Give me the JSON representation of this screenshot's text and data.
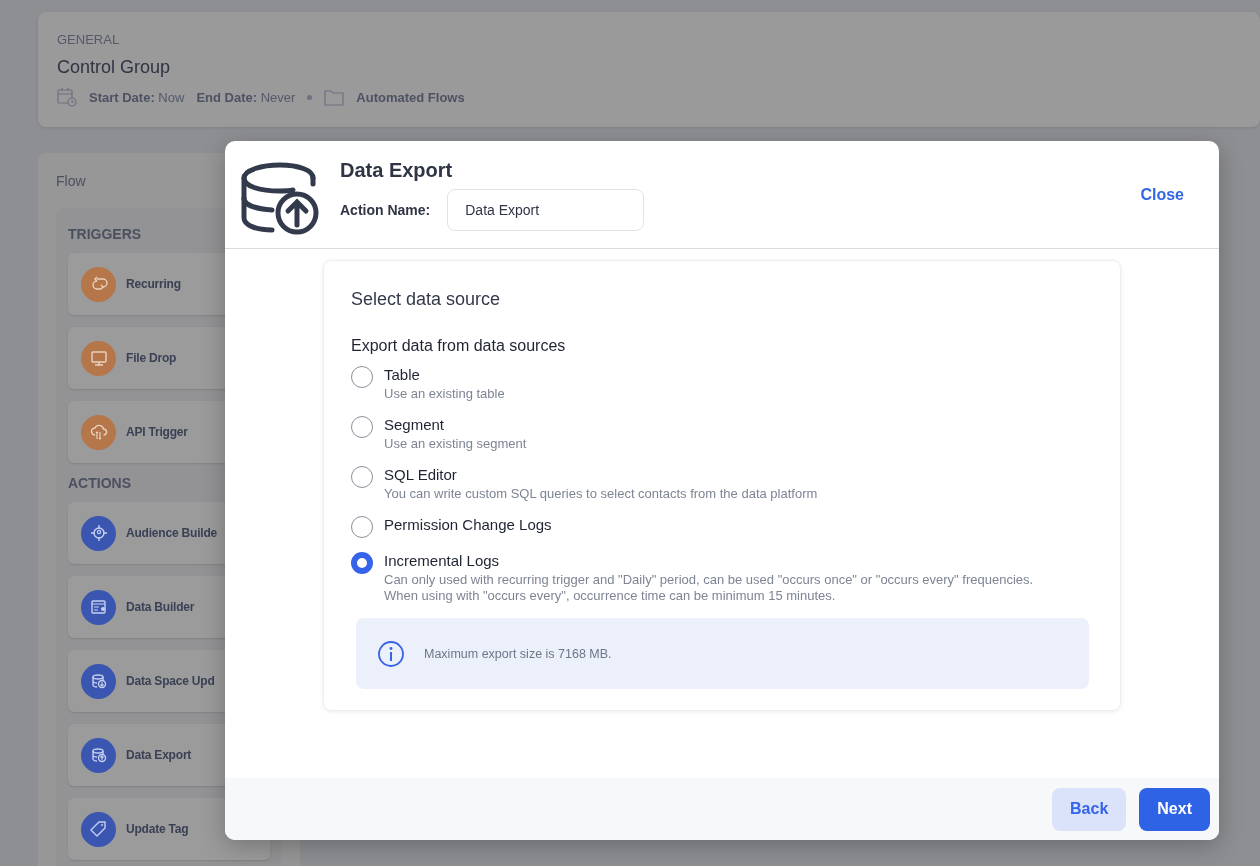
{
  "header": {
    "section": "GENERAL",
    "title": "Control Group",
    "start": "**Start Date:** Now",
    "end": "**End Date:** Never",
    "folder": "Automated Flows"
  },
  "flow": {
    "title": "Flow",
    "groups": [
      {
        "heading": "TRIGGERS",
        "items": [
          {
            "label": "Recurring",
            "kind": "trigger"
          },
          {
            "label": "File Drop",
            "kind": "trigger"
          },
          {
            "label": "API Trigger",
            "kind": "trigger"
          }
        ]
      },
      {
        "heading": "ACTIONS",
        "items": [
          {
            "label": "Audience Builde",
            "kind": "action"
          },
          {
            "label": "Data Builder",
            "kind": "action"
          },
          {
            "label": "Data Space Upd",
            "kind": "action"
          },
          {
            "label": "Data Export",
            "kind": "action"
          },
          {
            "label": "Update Tag",
            "kind": "action"
          }
        ]
      }
    ]
  },
  "modal": {
    "title": "Data Export",
    "action_name_label": "Action Name:",
    "action_name_value": "Data Export",
    "close": "Close",
    "section_title": "Select data source",
    "question": "Export data from data sources",
    "options": [
      {
        "label": "Table",
        "description": "Use an existing table",
        "selected": false
      },
      {
        "label": "Segment",
        "description": "Use an existing segment",
        "selected": false
      },
      {
        "label": "SQL Editor",
        "description": "You can write custom SQL queries to select contacts from the data platform",
        "selected": false
      },
      {
        "label": "Permission Change Logs",
        "selected": false
      },
      {
        "label": "Incremental Logs",
        "description": "Can only used with recurring trigger and \"Daily\" period, can be used \"occurs once\" or \"occurs every\" frequencies.\nWhen using with \"occurs every\", occurrence time can be minimum 15 minutes.",
        "selected": true
      }
    ],
    "info": "Maximum export size is 7168 MB.",
    "buttons": [
      {
        "label": "Back",
        "kind": "secondary"
      },
      {
        "label": "Next",
        "kind": "primary"
      }
    ]
  }
}
